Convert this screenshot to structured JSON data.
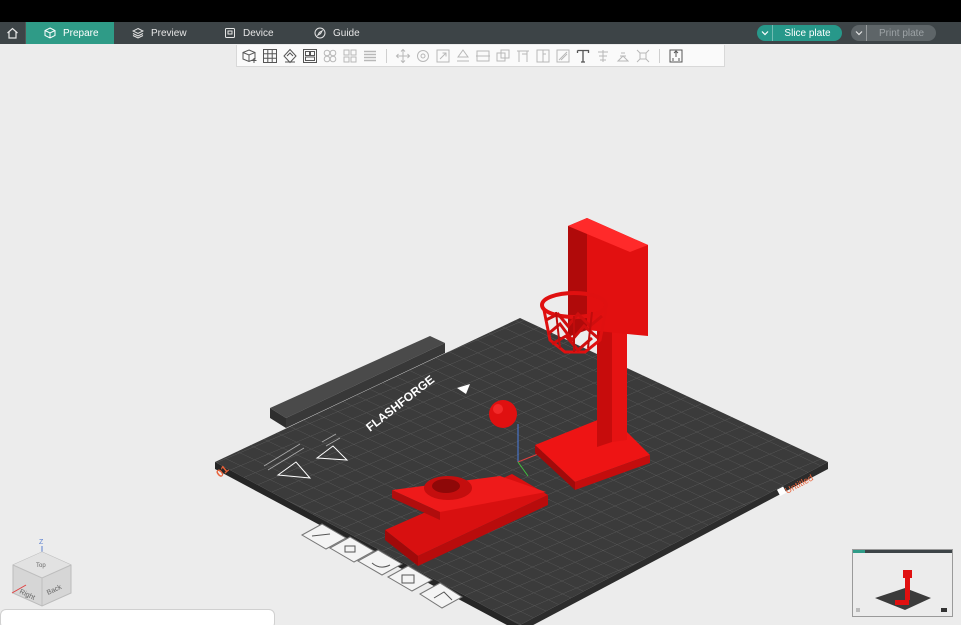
{
  "menu": {
    "tabs": [
      {
        "label": "Prepare",
        "icon": "cube-icon"
      },
      {
        "label": "Preview",
        "icon": "layers-icon"
      },
      {
        "label": "Device",
        "icon": "device-icon"
      },
      {
        "label": "Guide",
        "icon": "compass-icon"
      }
    ],
    "active_tab": "Prepare",
    "slice_label": "Slice plate",
    "print_label": "Print plate"
  },
  "toolbar": {
    "icons": [
      "add-cube-icon",
      "grid-icon",
      "orient-icon",
      "arrange-icon",
      "multi-object-icon",
      "split-objects-icon",
      "layers-bar-icon",
      "move-icon",
      "rotate-icon",
      "scale-icon",
      "lay-flat-icon",
      "cut-icon",
      "boolean-icon",
      "support-paint-icon",
      "seam-paint-icon",
      "color-paint-icon",
      "text-icon",
      "measure-icon",
      "assembly-icon",
      "fix-model-icon",
      "assemble-view-icon"
    ]
  },
  "bed": {
    "brand": "FLASHFORGE",
    "plate_number": "01",
    "plate_name": "Untitled"
  },
  "nav_cube": {
    "axis_z": "Z",
    "top": "Top",
    "right": "Right",
    "back": "Back"
  },
  "colors": {
    "accent": "#2f9b87",
    "menubar": "#3d4447",
    "model": "#e01010",
    "bed": "#3b3b3b"
  }
}
